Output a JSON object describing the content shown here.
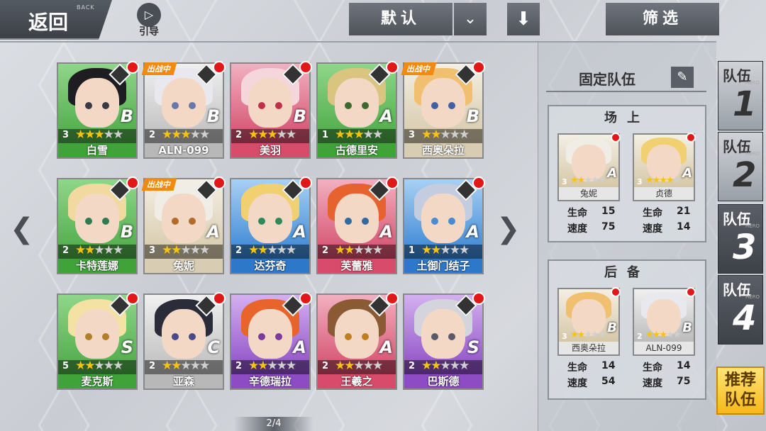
{
  "top": {
    "back_label": "返回",
    "back_sub": "BACK",
    "guide_label": "引导",
    "sort_label": "默认",
    "filter_label": "筛选"
  },
  "page_indicator": "2/4",
  "rows": [
    [
      {
        "name": "白雪",
        "level": "3",
        "stars": 3,
        "rank": "B",
        "color": "g",
        "hair": "#1e1e22",
        "eye": "#3a3a44",
        "deployed": false
      },
      {
        "name": "ALN-099",
        "level": "2",
        "stars": 3,
        "rank": "B",
        "color": "w",
        "hair": "#e8e8ee",
        "eye": "#6a78a8",
        "deployed": true
      },
      {
        "name": "美羽",
        "level": "2",
        "stars": 3,
        "rank": "B",
        "color": "r",
        "hair": "#f5d6dc",
        "eye": "#c0304a",
        "deployed": false
      },
      {
        "name": "古德里安",
        "level": "1",
        "stars": 3,
        "rank": "A",
        "color": "g",
        "hair": "#d9c580",
        "eye": "#3d6a2e",
        "deployed": false
      },
      {
        "name": "西奥朵拉",
        "level": "3",
        "stars": 2,
        "rank": "B",
        "color": "y",
        "hair": "#f0c070",
        "eye": "#4060a0",
        "deployed": true
      }
    ],
    [
      {
        "name": "卡特莲娜",
        "level": "2",
        "stars": 2,
        "rank": "B",
        "color": "g",
        "hair": "#f2d9a0",
        "eye": "#2f7a50",
        "deployed": false
      },
      {
        "name": "兔妮",
        "level": "3",
        "stars": 2,
        "rank": "A",
        "color": "y",
        "hair": "#f0ede6",
        "eye": "#b06a2a",
        "deployed": true
      },
      {
        "name": "达芬奇",
        "level": "2",
        "stars": 2,
        "rank": "A",
        "color": "b",
        "hair": "#f0d070",
        "eye": "#2f8a5a",
        "deployed": false
      },
      {
        "name": "芙蕾雅",
        "level": "2",
        "stars": 2,
        "rank": "A",
        "color": "r",
        "hair": "#e6622e",
        "eye": "#2f6aa0",
        "deployed": false
      },
      {
        "name": "土御门结子",
        "level": "1",
        "stars": 2,
        "rank": "A",
        "color": "b",
        "hair": "#c4cde0",
        "eye": "#4a8ad0",
        "deployed": false
      }
    ],
    [
      {
        "name": "麦克斯",
        "level": "5",
        "stars": 2,
        "rank": "S",
        "color": "g",
        "hair": "#f3e2a4",
        "eye": "#b0802a",
        "deployed": false
      },
      {
        "name": "亚森",
        "level": "2",
        "stars": 2,
        "rank": "C",
        "color": "w",
        "hair": "#2a2c3a",
        "eye": "#4a4a8a",
        "deployed": false
      },
      {
        "name": "辛德瑞拉",
        "level": "2",
        "stars": 2,
        "rank": "A",
        "color": "p",
        "hair": "#e8642a",
        "eye": "#7a3aa0",
        "deployed": false
      },
      {
        "name": "王羲之",
        "level": "2",
        "stars": 2,
        "rank": "A",
        "color": "r",
        "hair": "#8a5a34",
        "eye": "#c08020",
        "deployed": false
      },
      {
        "name": "巴斯德",
        "level": "2",
        "stars": 2,
        "rank": "S",
        "color": "p",
        "hair": "#d4d4dc",
        "eye": "#5a5a6a",
        "deployed": false
      }
    ]
  ],
  "deployed_tag": "出战中",
  "panel": {
    "title": "固定队伍",
    "onfield_header": "场上",
    "reserve_header": "后备",
    "hp_label": "生命",
    "spd_label": "速度",
    "onfield": [
      {
        "name": "兔妮",
        "level": "3",
        "stars": 2,
        "rank": "A",
        "hp": "15",
        "spd": "75",
        "hair": "#f0ede6",
        "color": "y"
      },
      {
        "name": "贞德",
        "level": "3",
        "stars": 4,
        "rank": "A",
        "hp": "21",
        "spd": "14",
        "hair": "#f0d070",
        "color": "y"
      }
    ],
    "reserve": [
      {
        "name": "西奥朵拉",
        "level": "3",
        "stars": 2,
        "rank": "B",
        "hp": "14",
        "spd": "54",
        "hair": "#f0c070",
        "color": "y"
      },
      {
        "name": "ALN-099",
        "level": "2",
        "stars": 3,
        "rank": "B",
        "hp": "14",
        "spd": "75",
        "hair": "#e8e8ee",
        "color": "w"
      }
    ]
  },
  "teams": [
    {
      "label": "队伍",
      "num": "1",
      "sub": "HERO",
      "selected": true
    },
    {
      "label": "队伍",
      "num": "2",
      "sub": "HERO",
      "selected": true
    },
    {
      "label": "队伍",
      "num": "3",
      "sub": "HERO",
      "selected": false
    },
    {
      "label": "队伍",
      "num": "4",
      "sub": "HERO",
      "selected": false
    }
  ],
  "recommend": {
    "line1": "推荐",
    "line2": "队伍"
  }
}
